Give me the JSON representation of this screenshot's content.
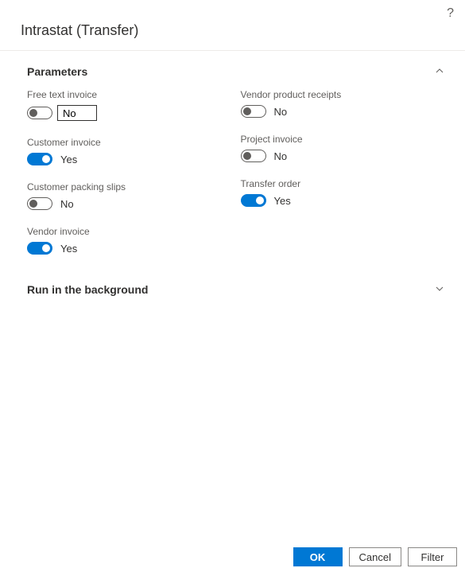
{
  "dialog": {
    "title": "Intrastat (Transfer)"
  },
  "sections": {
    "parameters": {
      "title": "Parameters",
      "expanded": true
    },
    "background": {
      "title": "Run in the background",
      "expanded": false
    }
  },
  "fields": {
    "free_text_invoice": {
      "label": "Free text invoice",
      "value": "No",
      "on": false,
      "has_input": true
    },
    "customer_invoice": {
      "label": "Customer invoice",
      "value": "Yes",
      "on": true
    },
    "customer_packing_slips": {
      "label": "Customer packing slips",
      "value": "No",
      "on": false
    },
    "vendor_invoice": {
      "label": "Vendor invoice",
      "value": "Yes",
      "on": true
    },
    "vendor_product_receipts": {
      "label": "Vendor product receipts",
      "value": "No",
      "on": false
    },
    "project_invoice": {
      "label": "Project invoice",
      "value": "No",
      "on": false
    },
    "transfer_order": {
      "label": "Transfer order",
      "value": "Yes",
      "on": true
    }
  },
  "buttons": {
    "ok": "OK",
    "cancel": "Cancel",
    "filter": "Filter"
  },
  "help_tooltip": "?"
}
